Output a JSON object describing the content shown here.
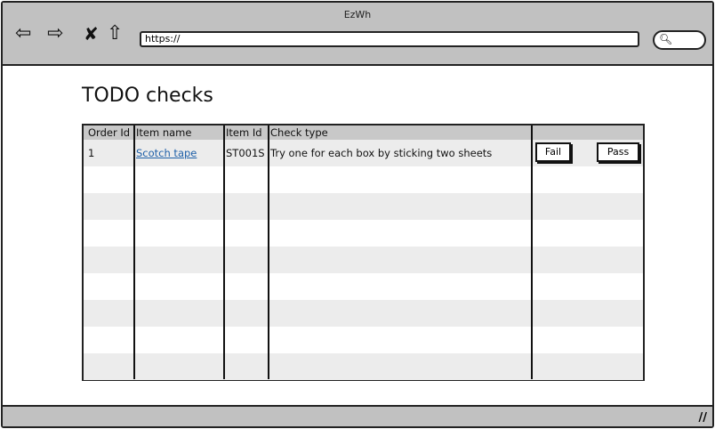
{
  "window": {
    "title": "EzWh",
    "url": "https://"
  },
  "icons": {
    "back": "arrow-left-icon",
    "forward": "arrow-right-icon",
    "stop": "close-icon",
    "home": "home-icon",
    "search": "search-icon",
    "resize": "resize-grip-icon"
  },
  "page": {
    "title": "TODO checks"
  },
  "table": {
    "columns": [
      "Order Id",
      "Item name",
      "Item Id",
      "Check type",
      ""
    ],
    "rows": [
      {
        "order_id": "1",
        "item_name": "Scotch tape",
        "item_id": "ST001S",
        "check_type": "Try one for each box by sticking two sheets",
        "fail_label": "Fail",
        "pass_label": "Pass"
      }
    ]
  },
  "colors": {
    "chrome": "#c1c1c1",
    "link": "#1d5fa8",
    "row_alt": "#ececec",
    "header": "#c8c8c8"
  }
}
